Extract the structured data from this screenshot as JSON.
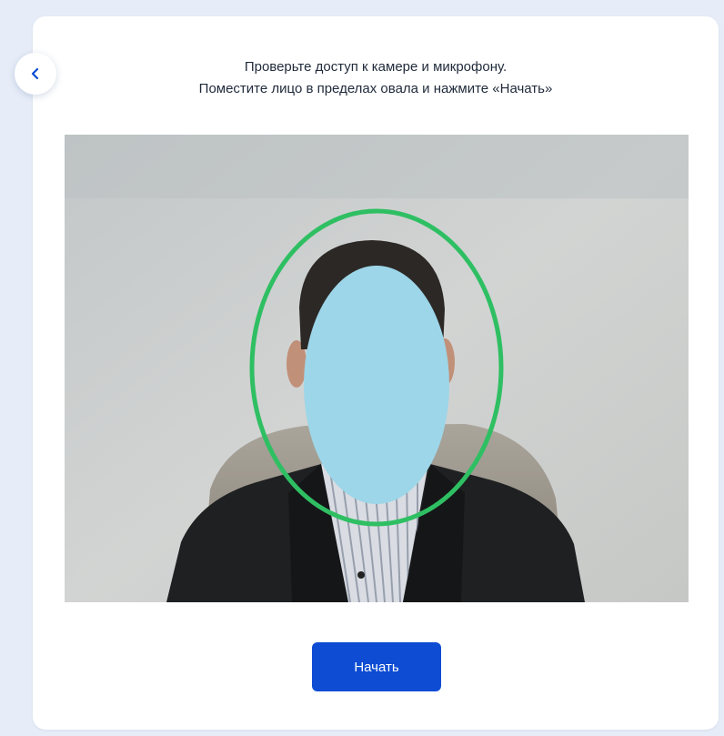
{
  "instructions": {
    "line1": "Проверьте доступ к камере и микрофону.",
    "line2": "Поместите лицо в пределах овала и нажмите «Начать»"
  },
  "back_button": {
    "icon": "chevron-left-icon"
  },
  "camera": {
    "face_guide_color": "#2fbf63",
    "face_mask_color": "#9dd6e8"
  },
  "start_button": {
    "label": "Начать",
    "color": "#0d4cd3"
  }
}
